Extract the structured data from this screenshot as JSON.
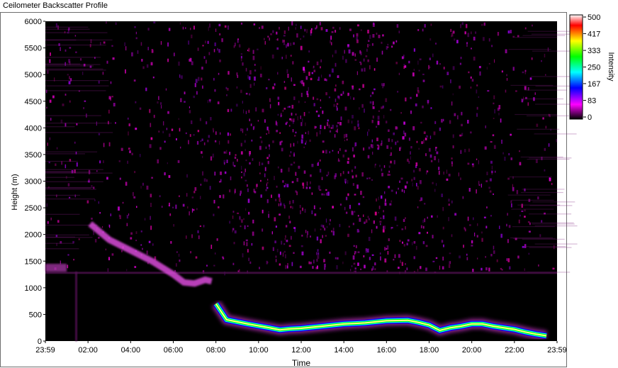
{
  "window": {
    "title": "Ceilometer Backscatter Profile"
  },
  "chart_data": {
    "type": "heatmap",
    "title": "Ceilometer Backscatter Profile",
    "xlabel": "Time",
    "ylabel": "Height (m)",
    "x_ticks": [
      "23:59",
      "02:00",
      "04:00",
      "06:00",
      "08:00",
      "10:00",
      "12:00",
      "14:00",
      "16:00",
      "18:00",
      "20:00",
      "22:00",
      "23:59"
    ],
    "y_ticks": [
      0,
      500,
      1000,
      1500,
      2000,
      2500,
      3000,
      3500,
      4000,
      4500,
      5000,
      5500,
      6000
    ],
    "ylim": [
      0,
      6000
    ],
    "colorbar": {
      "label": "Intensity",
      "ticks": [
        0,
        83,
        167,
        250,
        333,
        417,
        500
      ],
      "range": [
        0,
        500
      ],
      "colors": [
        "#000000",
        "#ff00ff",
        "#0000ff",
        "#00ffff",
        "#00ff00",
        "#ffff00",
        "#ff0000",
        "#ffffff"
      ]
    },
    "cloud_base": {
      "time_h": [
        8.0,
        8.5,
        9.5,
        10.5,
        11.0,
        11.5,
        12.0,
        13.0,
        14.0,
        15.0,
        16.0,
        17.0,
        17.5,
        18.0,
        18.5,
        19.0,
        19.5,
        20.0,
        20.5,
        21.0,
        22.0,
        22.5,
        23.0,
        23.5
      ],
      "height_m": [
        700,
        400,
        320,
        250,
        210,
        230,
        240,
        280,
        320,
        340,
        380,
        390,
        350,
        300,
        200,
        250,
        280,
        320,
        320,
        280,
        220,
        170,
        130,
        100
      ]
    },
    "aerosol_layer": {
      "time_h": [
        2.1,
        3.0,
        4.0,
        5.0,
        6.0,
        6.5,
        7.0,
        7.5,
        7.8
      ],
      "height_m": [
        2200,
        1900,
        1700,
        1500,
        1250,
        1100,
        1080,
        1150,
        1120
      ]
    },
    "residual_layer_height_m": 1300
  }
}
